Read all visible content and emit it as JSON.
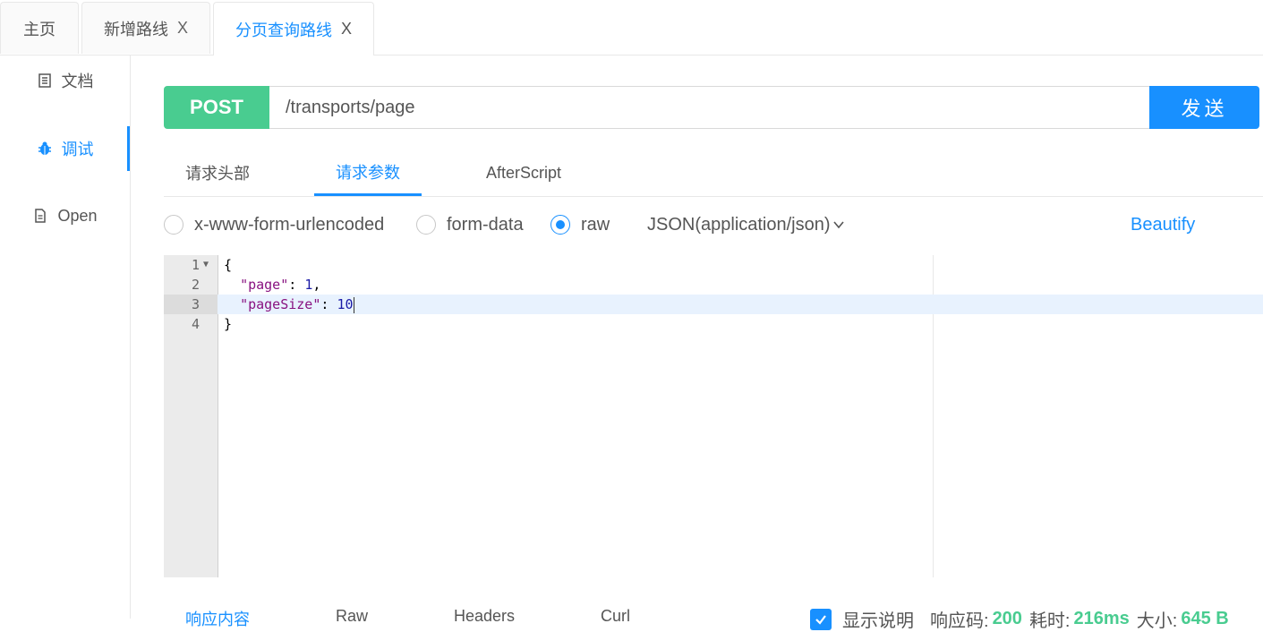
{
  "tabs": [
    {
      "label": "主页",
      "closable": false,
      "active": false
    },
    {
      "label": "新增路线",
      "closable": true,
      "active": false
    },
    {
      "label": "分页查询路线",
      "closable": true,
      "active": true
    }
  ],
  "close_glyph": "X",
  "sidebar": {
    "items": [
      {
        "label": "文档",
        "icon": "document-icon",
        "active": false
      },
      {
        "label": "调试",
        "icon": "bug-icon",
        "active": true
      },
      {
        "label": "Open",
        "icon": "file-icon",
        "active": false
      }
    ]
  },
  "request": {
    "method": "POST",
    "url": "/transports/page",
    "send_label": "发送"
  },
  "request_tabs": [
    {
      "label": "请求头部",
      "active": false
    },
    {
      "label": "请求参数",
      "active": true
    },
    {
      "label": "AfterScript",
      "active": false
    }
  ],
  "body_types": [
    {
      "label": "x-www-form-urlencoded",
      "checked": false
    },
    {
      "label": "form-data",
      "checked": false
    },
    {
      "label": "raw",
      "checked": true
    }
  ],
  "content_type": "JSON(application/json)",
  "beautify_label": "Beautify",
  "editor": {
    "lines": [
      {
        "num": "1",
        "text": "{"
      },
      {
        "num": "2",
        "key": "\"page\"",
        "sep": ": ",
        "value": "1",
        "tail": ","
      },
      {
        "num": "3",
        "key": "\"pageSize\"",
        "sep": ": ",
        "value": "10",
        "tail": ""
      },
      {
        "num": "4",
        "text": "}"
      }
    ]
  },
  "response": {
    "tabs": [
      {
        "label": "响应内容",
        "active": true
      },
      {
        "label": "Raw",
        "active": false
      },
      {
        "label": "Headers",
        "active": false
      },
      {
        "label": "Curl",
        "active": false
      }
    ],
    "show_desc_label": "显示说明",
    "status_code_label": "响应码:",
    "status_code": "200",
    "time_label": "耗时:",
    "time": "216ms",
    "size_label": "大小:",
    "size": "645 B"
  },
  "colors": {
    "accent": "#1890ff",
    "method_post": "#49cc90"
  }
}
